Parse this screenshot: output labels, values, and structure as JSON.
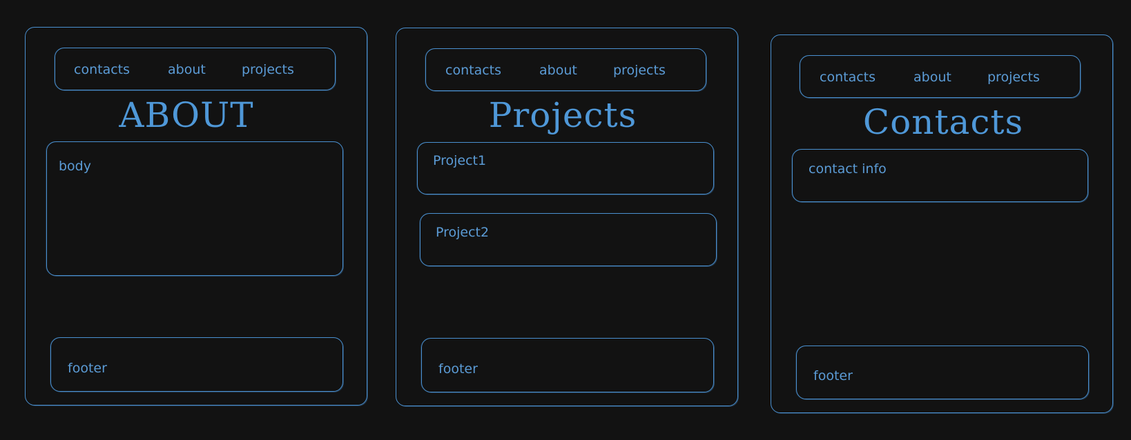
{
  "nav": {
    "items": [
      "contacts",
      "about",
      "projects"
    ]
  },
  "about_page": {
    "title": "ABOUT",
    "body_label": "body",
    "footer_label": "footer"
  },
  "projects_page": {
    "title": "Projects",
    "projects": [
      "Project1",
      "Project2"
    ],
    "footer_label": "footer"
  },
  "contacts_page": {
    "title": "Contacts",
    "info_label": "contact info",
    "footer_label": "footer"
  },
  "colors": {
    "background": "#121212",
    "stroke": "#4a90d0",
    "text": "#5b9bd5"
  }
}
